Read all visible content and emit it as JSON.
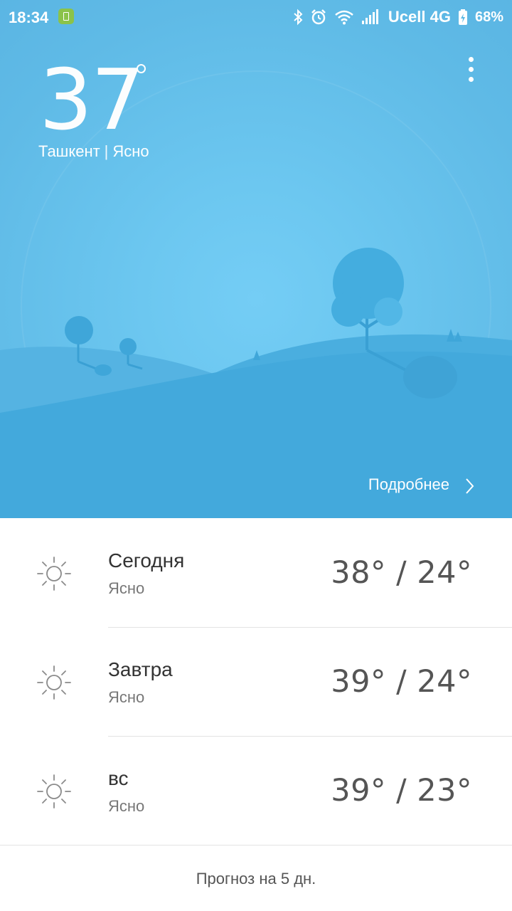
{
  "status": {
    "time": "18:34",
    "carrier": "Ucell 4G",
    "battery": "68%",
    "icons": [
      "battery-saver-icon",
      "bluetooth-icon",
      "alarm-icon",
      "wifi-icon",
      "signal-icon",
      "battery-icon"
    ]
  },
  "current": {
    "temperature": "37",
    "city": "Ташкент",
    "separator": "|",
    "condition": "Ясно"
  },
  "menu": {
    "icon": "more-vert-icon"
  },
  "details": {
    "label": "Подробнее",
    "icon": "chevron-right-icon"
  },
  "forecast": [
    {
      "day": "Сегодня",
      "condition": "Ясно",
      "range": "38° / 24°",
      "icon": "sun-icon"
    },
    {
      "day": "Завтра",
      "condition": "Ясно",
      "range": "39° / 24°",
      "icon": "sun-icon"
    },
    {
      "day": "вс",
      "condition": "Ясно",
      "range": "39° / 23°",
      "icon": "sun-icon"
    }
  ],
  "five_day_label": "Прогноз на 5 дн.",
  "colors": {
    "sky": "#62c0ea",
    "hill_back": "#53b0e0",
    "hill_front": "#3fa8da",
    "text_dark": "#333333"
  }
}
